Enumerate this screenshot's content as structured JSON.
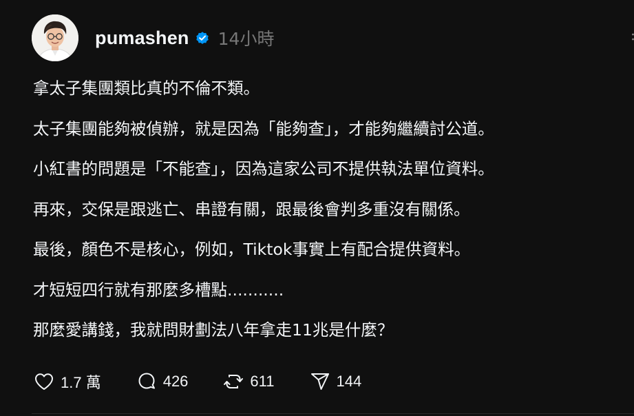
{
  "post": {
    "username": "pumashen",
    "timestamp": "14小時",
    "verified_color": "#0095f6",
    "lines": [
      "拿太子集團類比真的不倫不類。",
      "太子集團能夠被偵辦，就是因為「能夠查」，才能夠繼續討公道。",
      "小紅書的問題是「不能查」，因為這家公司不提供執法單位資料。",
      "再來，交保是跟逃亡、串證有關，跟最後會判多重沒有關係。",
      "最後，顏色不是核心，例如，Tiktok事實上有配合提供資料。",
      "才短短四行就有那麼多槽點...........",
      "那麼愛講錢，我就問財劃法八年拿走11兆是什麼？"
    ],
    "actions": {
      "like_count": "1.7 萬",
      "comment_count": "426",
      "repost_count": "611",
      "share_count": "144"
    },
    "icons": [
      "heart-icon",
      "comment-icon",
      "repost-icon",
      "share-icon",
      "verified-badge-icon"
    ]
  }
}
